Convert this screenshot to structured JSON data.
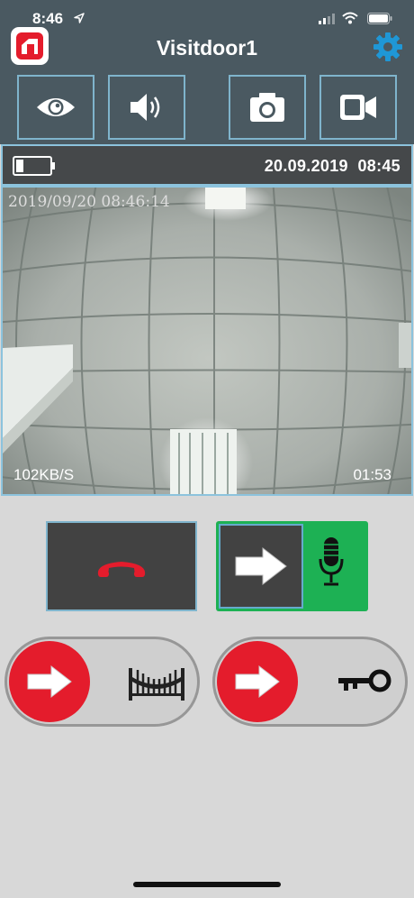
{
  "status_bar": {
    "time": "8:46",
    "icons": [
      "location-arrow-icon",
      "cellular-signal-icon",
      "wifi-icon",
      "battery-icon"
    ]
  },
  "header": {
    "title": "Visitdoor1",
    "logo_icon": "app-logo-icon",
    "settings_icon": "gear-icon"
  },
  "toolbar": {
    "buttons": [
      "eye-icon",
      "speaker-icon",
      "camera-icon",
      "video-camera-icon"
    ]
  },
  "info_bar": {
    "battery_icon": "battery-low-icon",
    "date": "20.09.2019",
    "time": "08:45"
  },
  "video": {
    "osd_timestamp": "2019/09/20 08:46:14",
    "bitrate": "102KB/S",
    "duration": "01:53"
  },
  "controls": {
    "hangup_icon": "phone-hangup-icon",
    "talk_icons": [
      "arrow-right-icon",
      "microphone-icon"
    ],
    "sliders": [
      {
        "name": "gate",
        "knob_icon": "arrow-right-icon",
        "end_icon": "gate-icon"
      },
      {
        "name": "door",
        "knob_icon": "arrow-right-icon",
        "end_icon": "key-icon"
      }
    ]
  },
  "colors": {
    "header": "#4a5961",
    "accent_blue": "#1f97d6",
    "red": "#e41c2c",
    "green": "#1db154",
    "dark": "#424242",
    "background": "#d8d8d8"
  }
}
